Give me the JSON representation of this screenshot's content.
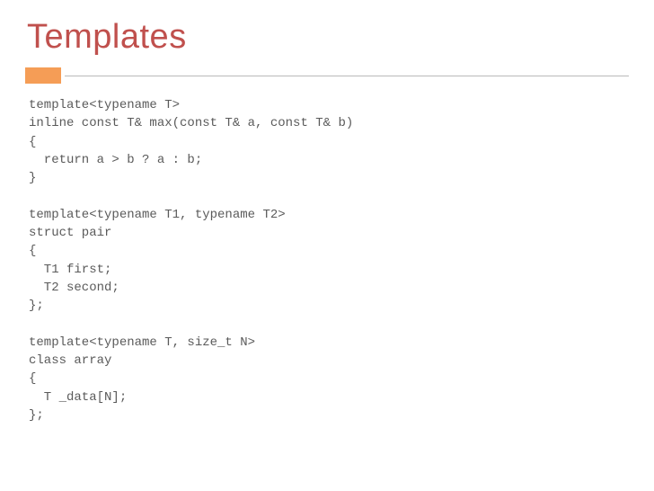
{
  "title": "Templates",
  "code": "template<typename T>\ninline const T& max(const T& a, const T& b)\n{\n  return a > b ? a : b;\n}\n\ntemplate<typename T1, typename T2>\nstruct pair\n{\n  T1 first;\n  T2 second;\n};\n\ntemplate<typename T, size_t N>\nclass array\n{\n  T _data[N];\n};"
}
